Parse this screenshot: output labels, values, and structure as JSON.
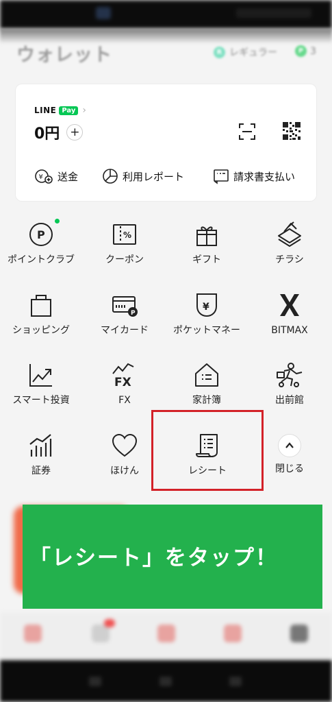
{
  "header": {
    "title": "ウォレット",
    "membership_badge_icon_letter": "R",
    "membership_label": "レギュラー",
    "points_badge_icon_letter": "P",
    "points_count": "3"
  },
  "pay_card": {
    "brand_line": "LINE",
    "brand_pay": "Pay",
    "balance": "0円",
    "actions": [
      {
        "label": "送金",
        "icon": "send-money-icon"
      },
      {
        "label": "利用レポート",
        "icon": "pie-chart-icon"
      },
      {
        "label": "請求書支払い",
        "icon": "invoice-icon"
      }
    ]
  },
  "menu": {
    "items": [
      {
        "label": "ポイントクラブ",
        "icon": "point-club-icon"
      },
      {
        "label": "クーポン",
        "icon": "coupon-icon"
      },
      {
        "label": "ギフト",
        "icon": "gift-icon"
      },
      {
        "label": "チラシ",
        "icon": "flyer-icon"
      },
      {
        "label": "ショッピング",
        "icon": "shopping-bag-icon"
      },
      {
        "label": "マイカード",
        "icon": "my-card-icon"
      },
      {
        "label": "ポケットマネー",
        "icon": "pocket-money-icon"
      },
      {
        "label": "BITMAX",
        "icon": "bitmax-icon"
      },
      {
        "label": "スマート投資",
        "icon": "smart-invest-icon"
      },
      {
        "label": "FX",
        "icon": "fx-icon"
      },
      {
        "label": "家計簿",
        "icon": "household-ledger-icon"
      },
      {
        "label": "出前館",
        "icon": "demaekan-icon"
      },
      {
        "label": "証券",
        "icon": "securities-icon"
      },
      {
        "label": "ほけん",
        "icon": "insurance-heart-icon"
      },
      {
        "label": "レシート",
        "icon": "receipt-icon"
      },
      {
        "label": "閉じる",
        "icon": "chevron-up-icon"
      }
    ]
  },
  "overlay": {
    "instruction": "「レシート」をタップ！",
    "highlight_color": "#d32128",
    "banner_color": "#23b14d"
  },
  "colors": {
    "line_green": "#06c755"
  }
}
